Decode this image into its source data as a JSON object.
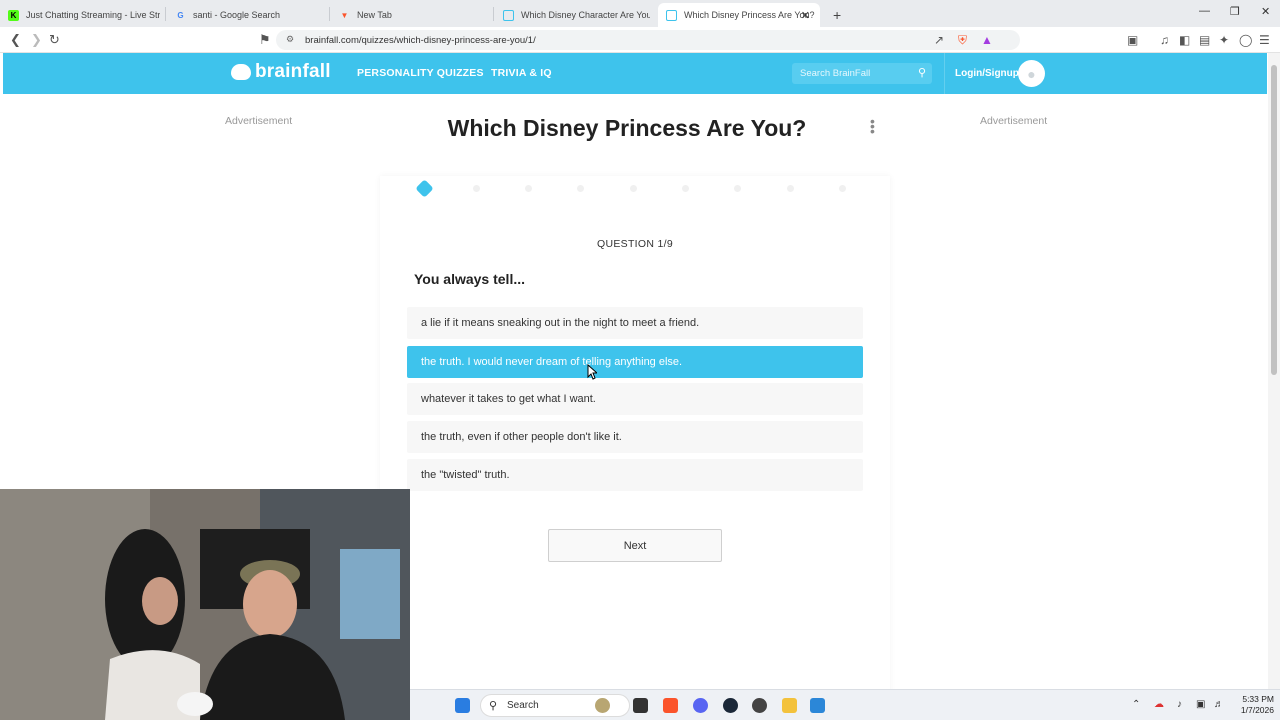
{
  "browser": {
    "tabs": [
      {
        "label": "Just Chatting Streaming - Live Stream",
        "favicon": "kick-icon",
        "color": "#53fc18"
      },
      {
        "label": "santi - Google Search",
        "favicon": "google-icon",
        "color": "#4285f4"
      },
      {
        "label": "New Tab",
        "favicon": "brave-icon",
        "color": "#fb542b"
      },
      {
        "label": "Which Disney Character Are You? | Br",
        "favicon": "brainfall-icon",
        "color": "#3ec3ec"
      },
      {
        "label": "Which Disney Princess Are You?",
        "favicon": "brainfall-icon",
        "color": "#3ec3ec"
      }
    ],
    "active_tab_index": 4,
    "new_tab_glyph": "+",
    "url": "brainfall.com/quizzes/which-disney-princess-are-you/1/"
  },
  "site": {
    "logo": "brainfall",
    "nav": [
      "PERSONALITY QUIZZES",
      "TRIVIA & IQ"
    ],
    "search_placeholder": "Search BrainFall",
    "login": "Login/Signup",
    "accent_color": "#3ec3ec"
  },
  "page": {
    "ad_left": "Advertisement",
    "ad_right": "Advertisement",
    "title": "Which Disney Princess Are You?"
  },
  "quiz": {
    "total_questions": 9,
    "current_question": 1,
    "question_label": "QUESTION 1/9",
    "question": "You always tell...",
    "options": [
      "a lie if it means sneaking out in the night to meet a friend.",
      "the truth. I would never dream of telling anything else.",
      "whatever it takes to get what I want.",
      "the truth, even if other people don't like it.",
      "the \"twisted\" truth."
    ],
    "selected_option_index": 1,
    "next_label": "Next"
  },
  "taskbar": {
    "search_label": "Search",
    "time": "5:33 PM",
    "date": "1/7/2026"
  }
}
